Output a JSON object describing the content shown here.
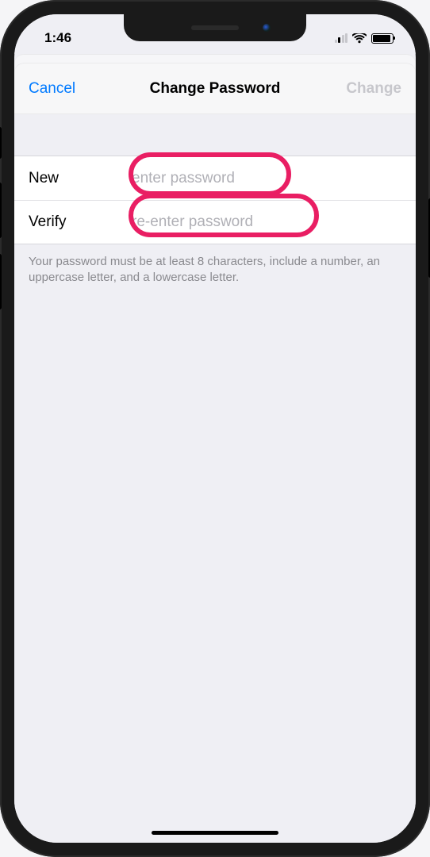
{
  "status": {
    "time": "1:46"
  },
  "nav": {
    "cancel": "Cancel",
    "title": "Change Password",
    "action": "Change"
  },
  "form": {
    "new_label": "New",
    "new_placeholder": "enter password",
    "verify_label": "Verify",
    "verify_placeholder": "re-enter password"
  },
  "helper": "Your password must be at least 8 characters, include a number, an uppercase letter, and a lowercase letter.",
  "colors": {
    "accent": "#007aff",
    "disabled": "#c7c7cc",
    "callout": "#e91e63"
  }
}
